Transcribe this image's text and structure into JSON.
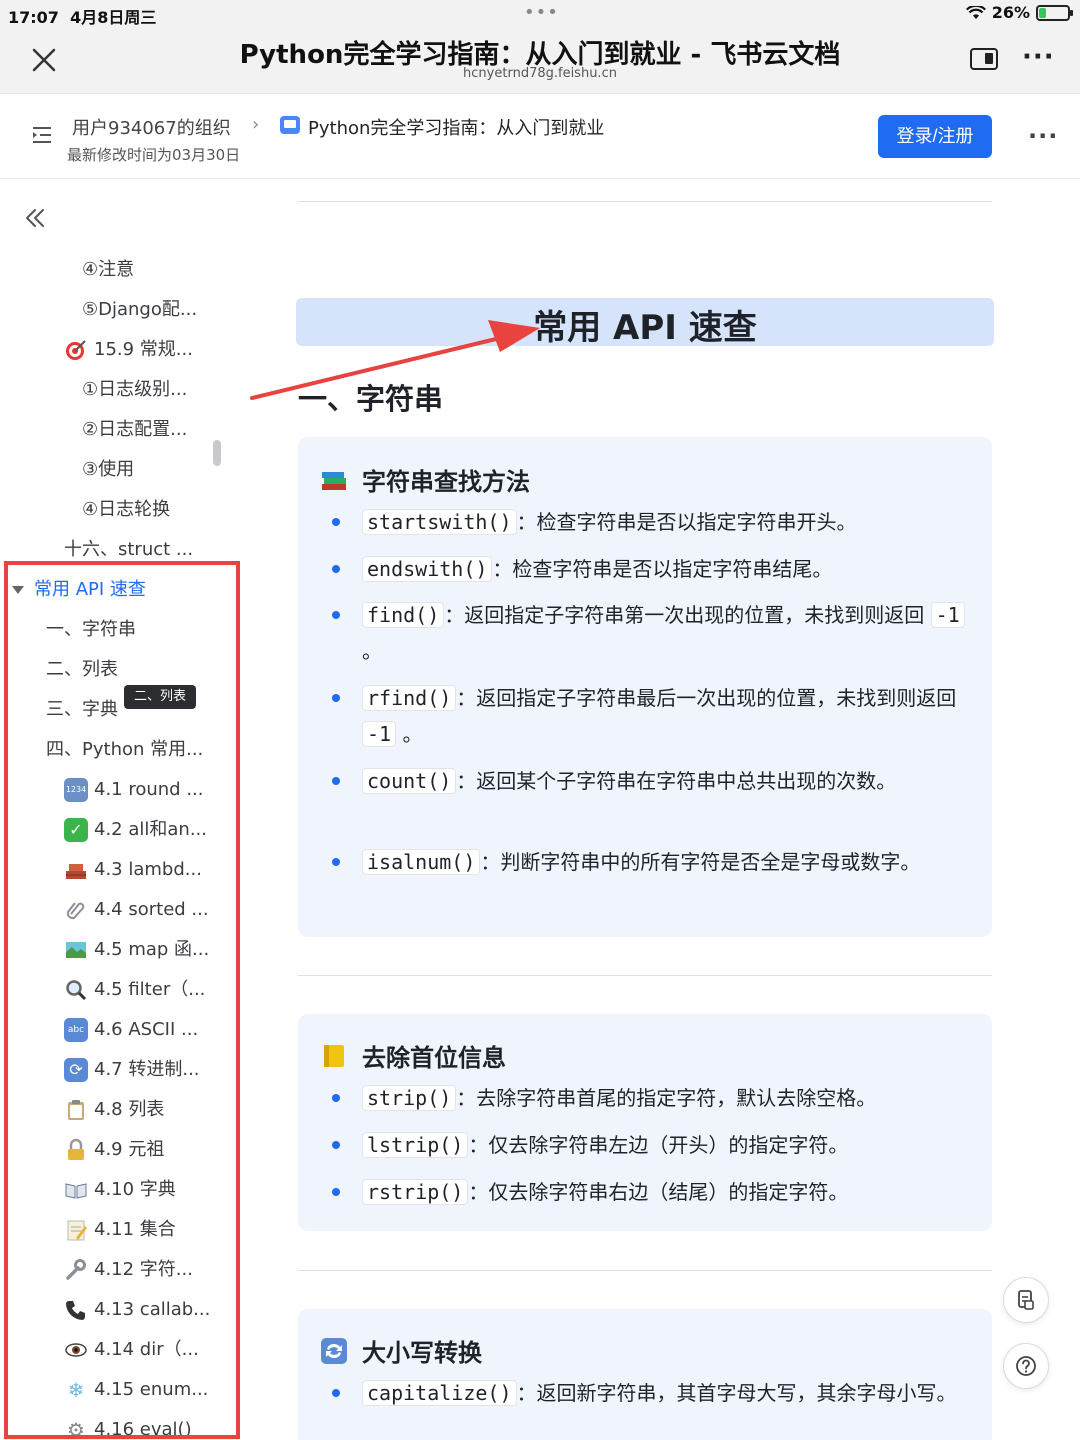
{
  "status_bar": {
    "time": "17:07",
    "date": "4月8日周三",
    "dots": "•••",
    "battery_percent": "26%",
    "battery_level": 0.26,
    "battery_color": "#34c759"
  },
  "browser": {
    "title": "Python完全学习指南：从入门到就业 - 飞书云文档",
    "url": "hcnyetrnd78g.feishu.cn",
    "more": "···"
  },
  "doc_header": {
    "org": "用户934067的组织",
    "chevron": "›",
    "doc_name": "Python完全学习指南：从入门到就业",
    "modified": "最新修改时间为03月30日",
    "login_label": "登录/注册",
    "more": "···",
    "accent_color": "#1f6bf2"
  },
  "sidebar": {
    "items": [
      {
        "label": "④注意"
      },
      {
        "label": "⑤Django配..."
      },
      {
        "label": "15.9 常规...",
        "icon": "dart-icon"
      },
      {
        "label": "①日志级别..."
      },
      {
        "label": "②日志配置..."
      },
      {
        "label": "③使用"
      },
      {
        "label": "④日志轮换"
      },
      {
        "label": "十六、struct ..."
      },
      {
        "label": "常用 API 速查",
        "active": true
      },
      {
        "label": "一、字符串"
      },
      {
        "label": "二、列表"
      },
      {
        "label": "三、字典"
      },
      {
        "label": "四、Python 常用..."
      },
      {
        "label": "4.1 round ...",
        "icon": "numbers-icon",
        "glyph": "1234"
      },
      {
        "label": "4.2 all和an...",
        "icon": "check-icon",
        "glyph": "✓"
      },
      {
        "label": "4.3 lambd...",
        "icon": "bricks-icon"
      },
      {
        "label": "4.4 sorted ...",
        "icon": "paperclip-icon"
      },
      {
        "label": "4.5 map 函...",
        "icon": "map-icon"
      },
      {
        "label": "4.5 filter（...",
        "icon": "magnifier-icon"
      },
      {
        "label": "4.6 ASCII ...",
        "icon": "abc-icon",
        "glyph": "abc"
      },
      {
        "label": "4.7 转进制...",
        "icon": "repeat-icon",
        "glyph": "⟳"
      },
      {
        "label": "4.8 列表",
        "icon": "clipboard-icon"
      },
      {
        "label": "4.9 元祖",
        "icon": "lock-icon"
      },
      {
        "label": "4.10 字典",
        "icon": "book-icon"
      },
      {
        "label": "4.11 集合",
        "icon": "memo-icon"
      },
      {
        "label": "4.12 字符...",
        "icon": "wrench-icon"
      },
      {
        "label": "4.13 callab...",
        "icon": "phone-icon"
      },
      {
        "label": "4.14 dir（...",
        "icon": "eye-icon"
      },
      {
        "label": "4.15 enum...",
        "icon": "snowflake-icon",
        "glyph": "❄"
      },
      {
        "label": "4.16 eval()",
        "icon": "gear-icon",
        "glyph": "⚙"
      }
    ],
    "tooltip": "二、列表",
    "frame_color": "#e8433f"
  },
  "content": {
    "section_title": "常用 API 速查",
    "h1": "一、字符串",
    "callouts": [
      {
        "title": "字符串查找方法",
        "icon": "books-icon",
        "items": [
          {
            "code": "startswith()",
            "text": "：检查字符串是否以指定字符串开头。"
          },
          {
            "code": "endswith()",
            "text": "：检查字符串是否以指定字符串结尾。"
          },
          {
            "code": "find()",
            "text": "：返回指定子字符串第一次出现的位置，未找到则返回",
            "code2": "-1",
            "tail": "。"
          },
          {
            "code": "rfind()",
            "text": "：返回指定子字符串最后一次出现的位置，未找到则返回",
            "code2": "-1",
            "tail": "。"
          },
          {
            "code": "count()",
            "text": "：返回某个子字符串在字符串中总共出现的次数。"
          },
          {
            "code": "isalnum()",
            "text": "：判断字符串中的所有字符是否全是字母或数字。"
          }
        ]
      },
      {
        "title": "去除首位信息",
        "icon": "note-icon",
        "items": [
          {
            "code": "strip()",
            "text": "：去除字符串首尾的指定字符，默认去除空格。"
          },
          {
            "code": "lstrip()",
            "text": "：仅去除字符串左边（开头）的指定字符。"
          },
          {
            "code": "rstrip()",
            "text": "：仅去除字符串右边（结尾）的指定字符。"
          }
        ]
      },
      {
        "title": "大小写转换",
        "icon": "repeat-icon",
        "items": [
          {
            "code": "capitalize()",
            "text": "：返回新字符串，其首字母大写，其余字母小写。"
          }
        ]
      }
    ],
    "annotation_color": "#e8433f"
  }
}
